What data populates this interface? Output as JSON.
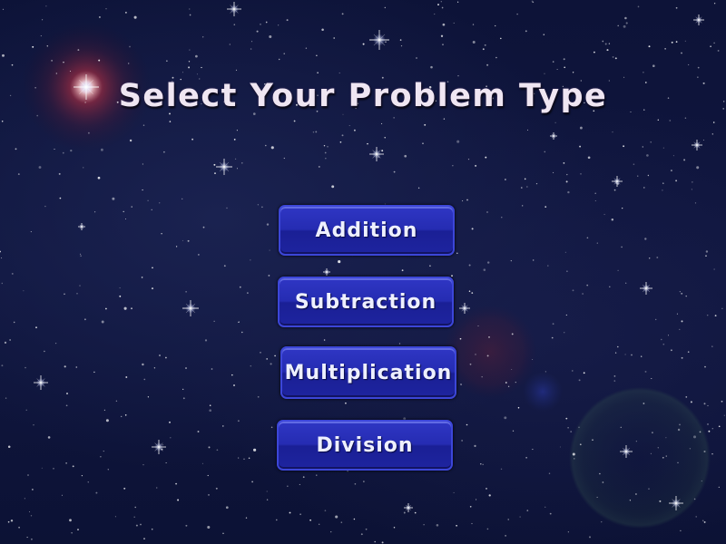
{
  "screen": {
    "title": "Select Your Problem Type",
    "background": "starfield"
  },
  "menu": {
    "buttons": [
      {
        "label": "Addition"
      },
      {
        "label": "Subtraction"
      },
      {
        "label": "Multiplication"
      },
      {
        "label": "Division"
      }
    ]
  },
  "colors": {
    "button_fill": "#252cb2",
    "button_border": "#3c46d8",
    "title_text": "#efe6f2",
    "background": "#0d1338"
  }
}
